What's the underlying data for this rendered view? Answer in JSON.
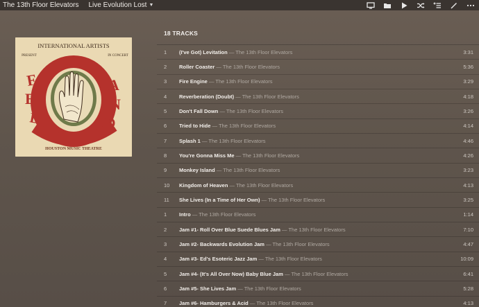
{
  "header": {
    "artist": "The 13th Floor Elevators",
    "album": "Live Evolution Lost"
  },
  "toolbar": {
    "buttons": [
      {
        "icon": "monitor-icon"
      },
      {
        "icon": "folder-icon"
      },
      {
        "icon": "play-icon"
      },
      {
        "icon": "shuffle-icon"
      },
      {
        "icon": "add-to-queue-icon"
      },
      {
        "icon": "edit-icon"
      },
      {
        "icon": "more-icon"
      }
    ]
  },
  "album_art": {
    "top_text": "INTERNATIONAL ARTISTS",
    "left_text": "PRESENT",
    "right_text": "IN CONCERT",
    "bottom_text": "HOUSTON MUSIC THEATRE"
  },
  "tracks_header": "18 TRACKS",
  "separator": "—",
  "tracks": [
    {
      "num": "1",
      "title": "(I've Got) Levitation",
      "artist": "The 13th Floor Elevators",
      "duration": "3:31"
    },
    {
      "num": "2",
      "title": "Roller Coaster",
      "artist": "The 13th Floor Elevators",
      "duration": "5:36"
    },
    {
      "num": "3",
      "title": "Fire Engine",
      "artist": "The 13th Floor Elevators",
      "duration": "3:29"
    },
    {
      "num": "4",
      "title": "Reverberation (Doubt)",
      "artist": "The 13th Floor Elevators",
      "duration": "4:18"
    },
    {
      "num": "5",
      "title": "Don't Fall Down",
      "artist": "The 13th Floor Elevators",
      "duration": "3:26"
    },
    {
      "num": "6",
      "title": "Tried to Hide",
      "artist": "The 13th Floor Elevators",
      "duration": "4:14"
    },
    {
      "num": "7",
      "title": "Splash 1",
      "artist": "The 13th Floor Elevators",
      "duration": "4:46"
    },
    {
      "num": "8",
      "title": "You're Gonna Miss Me",
      "artist": "The 13th Floor Elevators",
      "duration": "4:26"
    },
    {
      "num": "9",
      "title": "Monkey Island",
      "artist": "The 13th Floor Elevators",
      "duration": "3:23"
    },
    {
      "num": "10",
      "title": "Kingdom of Heaven",
      "artist": "The 13th Floor Elevators",
      "duration": "4:13"
    },
    {
      "num": "11",
      "title": "She Lives (In a Time of Her Own)",
      "artist": "The 13th Floor Elevators",
      "duration": "3:25"
    },
    {
      "num": "1",
      "title": "Intro",
      "artist": "The 13th Floor Elevators",
      "duration": "1:14"
    },
    {
      "num": "2",
      "title": "Jam #1- Roll Over Blue Suede Blues Jam",
      "artist": "The 13th Floor Elevators",
      "duration": "7:10"
    },
    {
      "num": "3",
      "title": "Jam #2- Backwards Evolution Jam",
      "artist": "The 13th Floor Elevators",
      "duration": "4:47"
    },
    {
      "num": "4",
      "title": "Jam #3- Ed's Esoteric Jazz Jam",
      "artist": "The 13th Floor Elevators",
      "duration": "10:09"
    },
    {
      "num": "5",
      "title": "Jam #4- (It's All Over Now) Baby Blue Jam",
      "artist": "The 13th Floor Elevators",
      "duration": "6:41"
    },
    {
      "num": "6",
      "title": "Jam #5- She Lives Jam",
      "artist": "The 13th Floor Elevators",
      "duration": "5:28"
    },
    {
      "num": "7",
      "title": "Jam #6- Hamburgers & Acid",
      "artist": "The 13th Floor Elevators",
      "duration": "4:13"
    }
  ]
}
